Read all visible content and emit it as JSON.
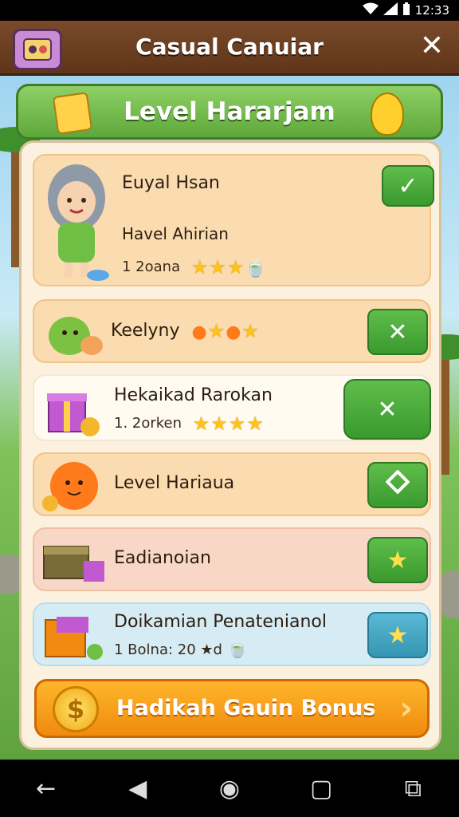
{
  "status": {
    "time": "12:33"
  },
  "header": {
    "title": "Casual Canuiar",
    "close_icon": "close-icon"
  },
  "banner": {
    "title": "Level Hararjam"
  },
  "rows": [
    {
      "title": "Euyal Hsan",
      "subtitle": "Havel Ahirian",
      "detail": "1 2oana",
      "action": "check"
    },
    {
      "title": "Keelyny",
      "action": "close"
    },
    {
      "title": "Hekaikad Rarokan",
      "detail": "1. 2orken",
      "action": "close-highlight"
    },
    {
      "title": "Level Hariaua",
      "action": "tag"
    },
    {
      "title": "Eadianoian",
      "action": "star"
    },
    {
      "title": "Doikamian Penatenianol",
      "detail": "1 Bolna: 20 ★d",
      "action": "star"
    }
  ],
  "bonus": {
    "label": "Hadikah Gauin Bonus",
    "coin_symbol": "$"
  },
  "colors": {
    "accent_green": "#5fbd4a",
    "accent_orange": "#f08a10",
    "accent_teal": "#3596b3"
  }
}
